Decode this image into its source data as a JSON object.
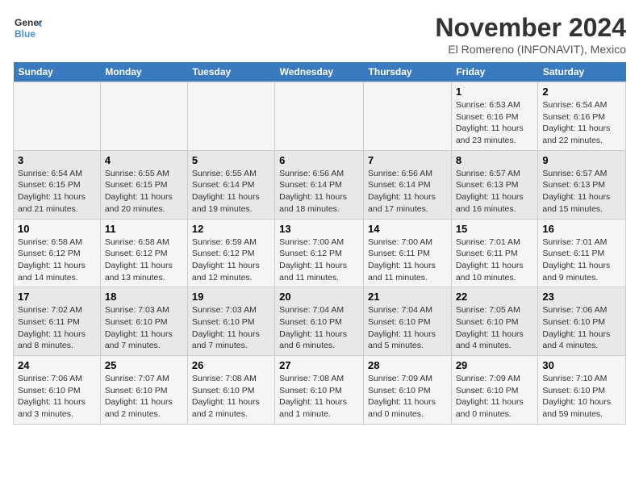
{
  "logo": {
    "line1": "General",
    "line2": "Blue"
  },
  "title": "November 2024",
  "subtitle": "El Romereno (INFONAVIT), Mexico",
  "days_of_week": [
    "Sunday",
    "Monday",
    "Tuesday",
    "Wednesday",
    "Thursday",
    "Friday",
    "Saturday"
  ],
  "weeks": [
    [
      {
        "day": "",
        "info": ""
      },
      {
        "day": "",
        "info": ""
      },
      {
        "day": "",
        "info": ""
      },
      {
        "day": "",
        "info": ""
      },
      {
        "day": "",
        "info": ""
      },
      {
        "day": "1",
        "info": "Sunrise: 6:53 AM\nSunset: 6:16 PM\nDaylight: 11 hours and 23 minutes."
      },
      {
        "day": "2",
        "info": "Sunrise: 6:54 AM\nSunset: 6:16 PM\nDaylight: 11 hours and 22 minutes."
      }
    ],
    [
      {
        "day": "3",
        "info": "Sunrise: 6:54 AM\nSunset: 6:15 PM\nDaylight: 11 hours and 21 minutes."
      },
      {
        "day": "4",
        "info": "Sunrise: 6:55 AM\nSunset: 6:15 PM\nDaylight: 11 hours and 20 minutes."
      },
      {
        "day": "5",
        "info": "Sunrise: 6:55 AM\nSunset: 6:14 PM\nDaylight: 11 hours and 19 minutes."
      },
      {
        "day": "6",
        "info": "Sunrise: 6:56 AM\nSunset: 6:14 PM\nDaylight: 11 hours and 18 minutes."
      },
      {
        "day": "7",
        "info": "Sunrise: 6:56 AM\nSunset: 6:14 PM\nDaylight: 11 hours and 17 minutes."
      },
      {
        "day": "8",
        "info": "Sunrise: 6:57 AM\nSunset: 6:13 PM\nDaylight: 11 hours and 16 minutes."
      },
      {
        "day": "9",
        "info": "Sunrise: 6:57 AM\nSunset: 6:13 PM\nDaylight: 11 hours and 15 minutes."
      }
    ],
    [
      {
        "day": "10",
        "info": "Sunrise: 6:58 AM\nSunset: 6:12 PM\nDaylight: 11 hours and 14 minutes."
      },
      {
        "day": "11",
        "info": "Sunrise: 6:58 AM\nSunset: 6:12 PM\nDaylight: 11 hours and 13 minutes."
      },
      {
        "day": "12",
        "info": "Sunrise: 6:59 AM\nSunset: 6:12 PM\nDaylight: 11 hours and 12 minutes."
      },
      {
        "day": "13",
        "info": "Sunrise: 7:00 AM\nSunset: 6:12 PM\nDaylight: 11 hours and 11 minutes."
      },
      {
        "day": "14",
        "info": "Sunrise: 7:00 AM\nSunset: 6:11 PM\nDaylight: 11 hours and 11 minutes."
      },
      {
        "day": "15",
        "info": "Sunrise: 7:01 AM\nSunset: 6:11 PM\nDaylight: 11 hours and 10 minutes."
      },
      {
        "day": "16",
        "info": "Sunrise: 7:01 AM\nSunset: 6:11 PM\nDaylight: 11 hours and 9 minutes."
      }
    ],
    [
      {
        "day": "17",
        "info": "Sunrise: 7:02 AM\nSunset: 6:11 PM\nDaylight: 11 hours and 8 minutes."
      },
      {
        "day": "18",
        "info": "Sunrise: 7:03 AM\nSunset: 6:10 PM\nDaylight: 11 hours and 7 minutes."
      },
      {
        "day": "19",
        "info": "Sunrise: 7:03 AM\nSunset: 6:10 PM\nDaylight: 11 hours and 7 minutes."
      },
      {
        "day": "20",
        "info": "Sunrise: 7:04 AM\nSunset: 6:10 PM\nDaylight: 11 hours and 6 minutes."
      },
      {
        "day": "21",
        "info": "Sunrise: 7:04 AM\nSunset: 6:10 PM\nDaylight: 11 hours and 5 minutes."
      },
      {
        "day": "22",
        "info": "Sunrise: 7:05 AM\nSunset: 6:10 PM\nDaylight: 11 hours and 4 minutes."
      },
      {
        "day": "23",
        "info": "Sunrise: 7:06 AM\nSunset: 6:10 PM\nDaylight: 11 hours and 4 minutes."
      }
    ],
    [
      {
        "day": "24",
        "info": "Sunrise: 7:06 AM\nSunset: 6:10 PM\nDaylight: 11 hours and 3 minutes."
      },
      {
        "day": "25",
        "info": "Sunrise: 7:07 AM\nSunset: 6:10 PM\nDaylight: 11 hours and 2 minutes."
      },
      {
        "day": "26",
        "info": "Sunrise: 7:08 AM\nSunset: 6:10 PM\nDaylight: 11 hours and 2 minutes."
      },
      {
        "day": "27",
        "info": "Sunrise: 7:08 AM\nSunset: 6:10 PM\nDaylight: 11 hours and 1 minute."
      },
      {
        "day": "28",
        "info": "Sunrise: 7:09 AM\nSunset: 6:10 PM\nDaylight: 11 hours and 0 minutes."
      },
      {
        "day": "29",
        "info": "Sunrise: 7:09 AM\nSunset: 6:10 PM\nDaylight: 11 hours and 0 minutes."
      },
      {
        "day": "30",
        "info": "Sunrise: 7:10 AM\nSunset: 6:10 PM\nDaylight: 10 hours and 59 minutes."
      }
    ]
  ]
}
